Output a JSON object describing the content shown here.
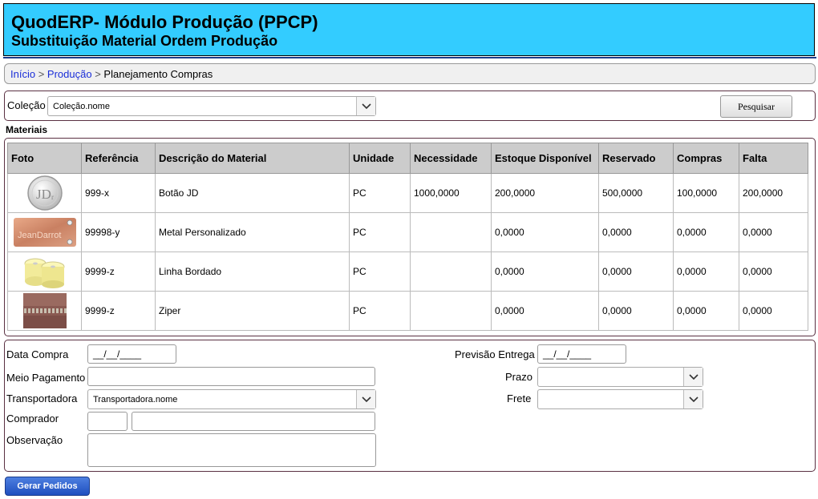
{
  "header": {
    "title": "QuodERP- Módulo Produção (PPCP)",
    "subtitle": "Substituição Material Ordem Produção"
  },
  "breadcrumb": {
    "home": "Início",
    "separator": ">",
    "section": "Produção",
    "current": "Planejamento Compras"
  },
  "search": {
    "colecao_label": "Coleção",
    "colecao_value": "Coleção.nome",
    "button": "Pesquisar"
  },
  "materials": {
    "section_label": "Materiais",
    "columns": [
      "Foto",
      "Referência",
      "Descrição do Material",
      "Unidade",
      "Necessidade",
      "Estoque Disponível",
      "Reservado",
      "Compras",
      "Falta"
    ],
    "rows": [
      {
        "thumb": "jd-button-icon",
        "referencia": "999-x",
        "descricao": "Botão JD",
        "unidade": "PC",
        "necessidade": "1000,0000",
        "estoque": "200,0000",
        "reservado": "500,0000",
        "compras": "100,0000",
        "falta": "200,0000"
      },
      {
        "thumb": "metal-plate-icon",
        "thumb_text": "JeanDarrot",
        "referencia": "99998-y",
        "descricao": "Metal Personalizado",
        "unidade": "PC",
        "necessidade": "",
        "estoque": "0,0000",
        "reservado": "0,0000",
        "compras": "0,0000",
        "falta": "0,0000"
      },
      {
        "thumb": "thread-spools-icon",
        "referencia": "9999-z",
        "descricao": "Linha Bordado",
        "unidade": "PC",
        "necessidade": "",
        "estoque": "0,0000",
        "reservado": "0,0000",
        "compras": "0,0000",
        "falta": "0,0000"
      },
      {
        "thumb": "zipper-icon",
        "referencia": "9999-z",
        "descricao": "Ziper",
        "unidade": "PC",
        "necessidade": "",
        "estoque": "0,0000",
        "reservado": "0,0000",
        "compras": "0,0000",
        "falta": "0,0000"
      }
    ]
  },
  "order_form": {
    "data_compra_label": "Data Compra",
    "data_compra_value": "__/__/____",
    "previsao_label": "Previsão Entrega",
    "previsao_value": "__/__/____",
    "meio_pagamento_label": "Meio Pagamento",
    "prazo_label": "Prazo",
    "transportadora_label": "Transportadora",
    "transportadora_value": "Transportadora.nome",
    "frete_label": "Frete",
    "comprador_label": "Comprador",
    "observacao_label": "Observação"
  },
  "actions": {
    "gerar_pedidos": "Gerar Pedidos"
  }
}
